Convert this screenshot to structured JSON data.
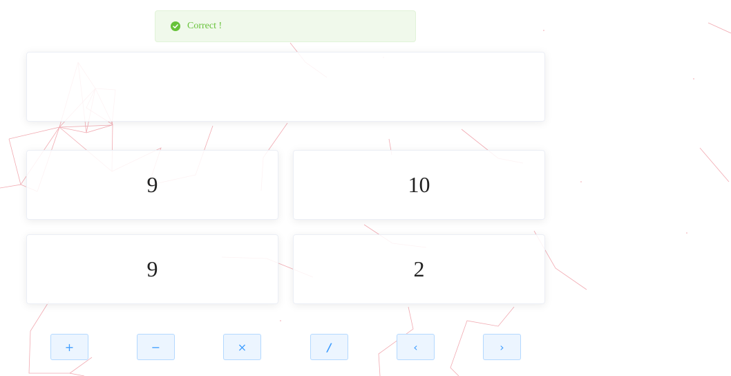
{
  "toast": {
    "message": "Correct !",
    "type": "success",
    "icon": "check-circle-icon",
    "color": "#67c23a"
  },
  "result": {
    "text": ""
  },
  "numbers": [
    {
      "value": "9"
    },
    {
      "value": "10"
    },
    {
      "value": "9"
    },
    {
      "value": "2"
    }
  ],
  "buttons": {
    "add": "+",
    "subtract": "−",
    "multiply": "×",
    "divide": "/",
    "undo": "‹",
    "redo": "›"
  },
  "theme": {
    "accent": "#409eff",
    "success": "#67c23a",
    "line": "#f0a0a8"
  }
}
